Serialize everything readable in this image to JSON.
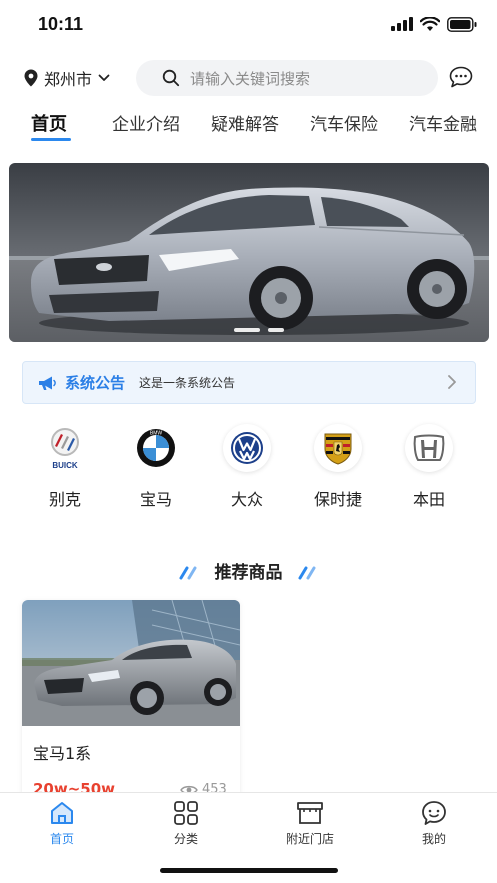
{
  "status": {
    "time": "10:11"
  },
  "header": {
    "city": "郑州市",
    "search_placeholder": "请输入关键词搜索"
  },
  "tabs": [
    {
      "label": "首页",
      "active": true
    },
    {
      "label": "企业介绍"
    },
    {
      "label": "疑难解答"
    },
    {
      "label": "汽车保险"
    },
    {
      "label": "汽车金融"
    }
  ],
  "notice": {
    "title": "系统公告",
    "text": "这是一条系统公告"
  },
  "brands": [
    {
      "name": "别克",
      "logo": "buick-logo",
      "logo_text": "BUICK"
    },
    {
      "name": "宝马",
      "logo": "bmw-logo",
      "logo_text": "BMW"
    },
    {
      "name": "大众",
      "logo": "volkswagen-logo"
    },
    {
      "name": "保时捷",
      "logo": "porsche-logo"
    },
    {
      "name": "本田",
      "logo": "honda-logo"
    }
  ],
  "section": {
    "title": "推荐商品"
  },
  "products": [
    {
      "title": "宝马1系",
      "price": "20w~50w",
      "views": "453"
    }
  ],
  "tabbar": [
    {
      "label": "首页",
      "icon": "home-icon",
      "active": true
    },
    {
      "label": "分类",
      "icon": "category-icon"
    },
    {
      "label": "附近门店",
      "icon": "store-icon"
    },
    {
      "label": "我的",
      "icon": "profile-icon"
    }
  ],
  "colors": {
    "accent": "#2b88ee",
    "price": "#e8412f",
    "notice_bg": "#eef5fd"
  }
}
